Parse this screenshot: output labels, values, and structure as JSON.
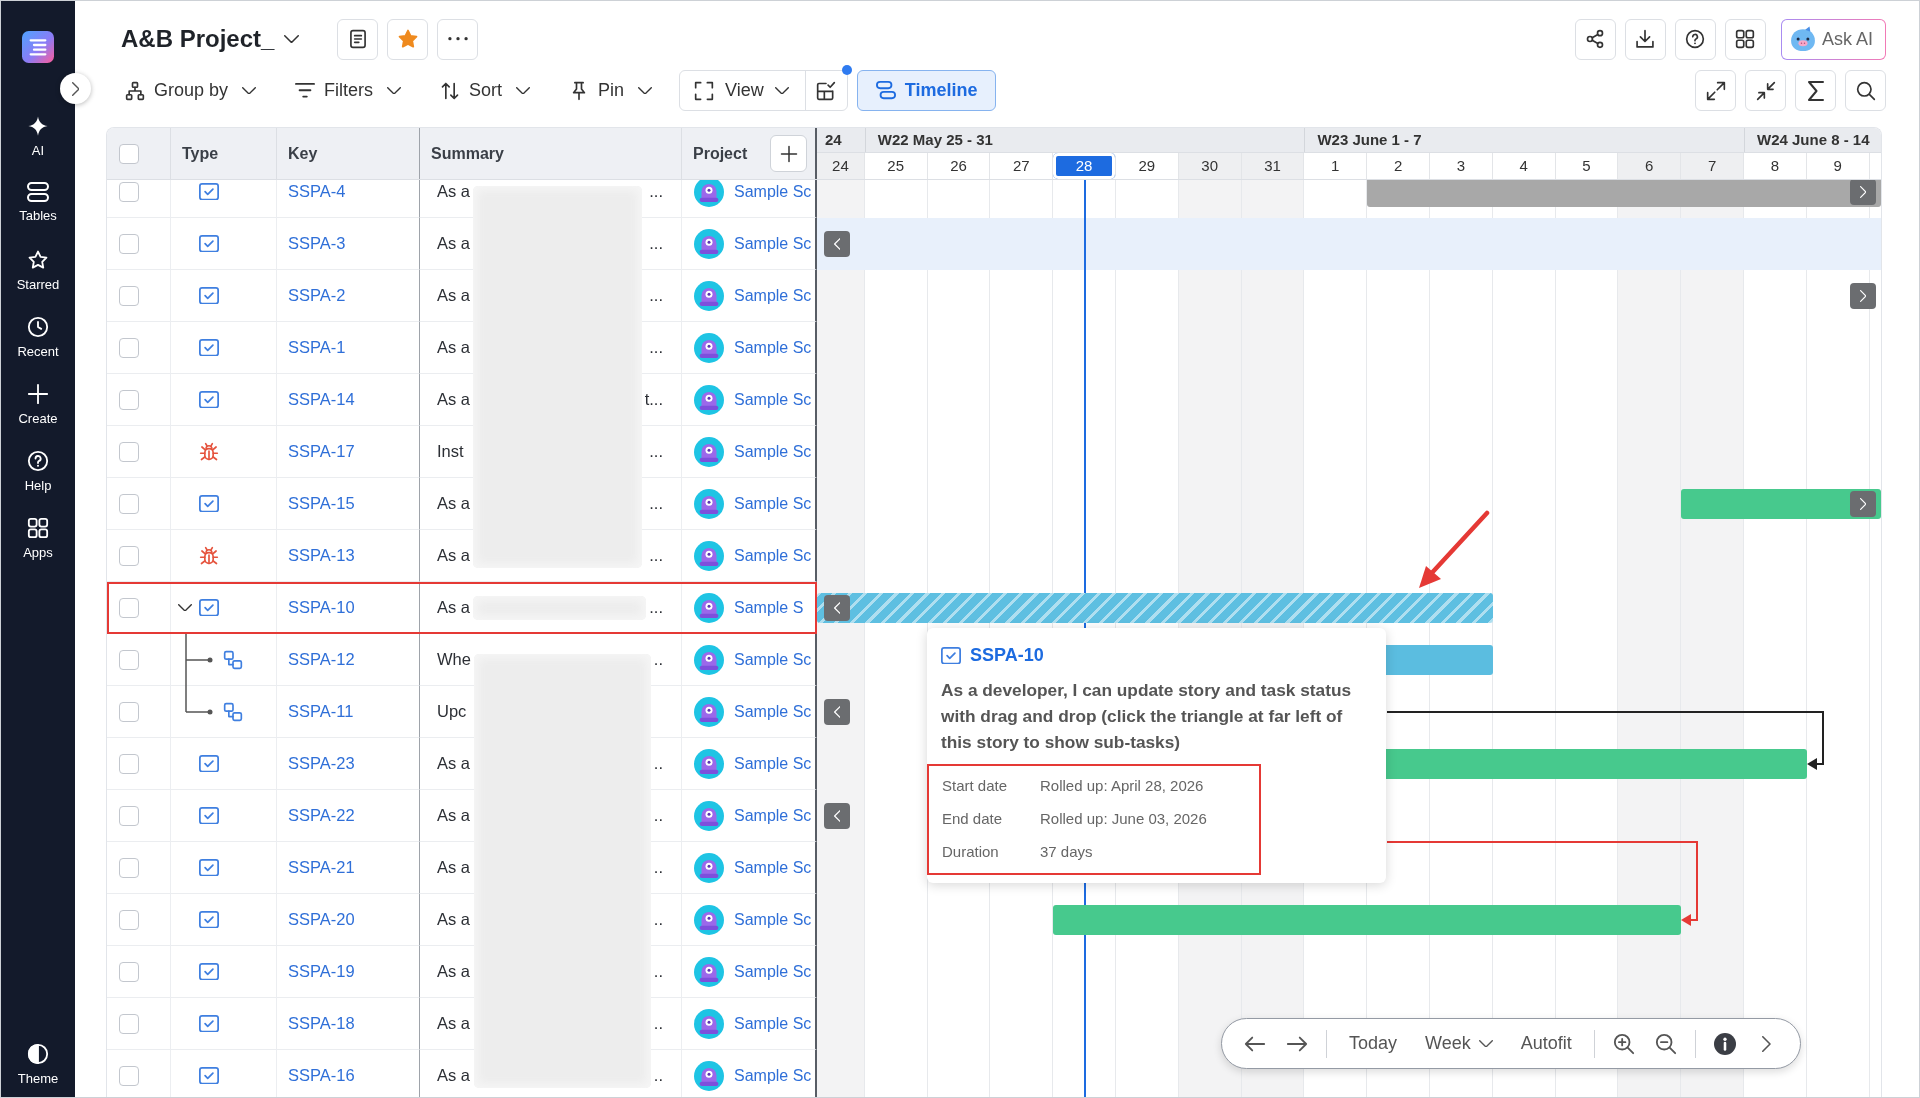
{
  "sidebar": {
    "items": [
      {
        "kind": "ai",
        "label": "AI"
      },
      {
        "kind": "tables",
        "label": "Tables"
      },
      {
        "kind": "starred",
        "label": "Starred"
      },
      {
        "kind": "recent",
        "label": "Recent"
      },
      {
        "kind": "create",
        "label": "Create"
      },
      {
        "kind": "help",
        "label": "Help"
      },
      {
        "kind": "apps",
        "label": "Apps"
      }
    ],
    "footer": [
      {
        "kind": "theme",
        "label": "Theme"
      }
    ]
  },
  "header": {
    "title": "A&B Project_",
    "buttons": [
      {
        "kind": "details"
      },
      {
        "kind": "favorite",
        "starred": true
      },
      {
        "kind": "more"
      }
    ],
    "actions": [
      {
        "kind": "share"
      },
      {
        "kind": "download"
      },
      {
        "kind": "help"
      },
      {
        "kind": "apps"
      },
      {
        "kind": "ask-ai",
        "label": "Ask AI"
      }
    ]
  },
  "toolbar": {
    "items": [
      {
        "kind": "group",
        "label": "Group by"
      },
      {
        "kind": "filter",
        "label": "Filters"
      },
      {
        "kind": "sort",
        "label": "Sort"
      },
      {
        "kind": "pin",
        "label": "Pin"
      }
    ],
    "view": {
      "label": "View",
      "layout_badge": true
    },
    "modes": [
      {
        "label": "Timeline",
        "selected": true
      }
    ],
    "tools": [
      {
        "kind": "expand"
      },
      {
        "kind": "collapse"
      },
      {
        "kind": "sum"
      },
      {
        "kind": "search"
      }
    ]
  },
  "table": {
    "select_all": {
      "checked": false
    },
    "columns": [
      "Type",
      "Key",
      "Summary",
      "Project"
    ],
    "rows": [
      {
        "kind": "story",
        "key": "SSPA-4",
        "summary_start": "As a",
        "summary_end": "...",
        "redaction": {
          "kind": "block"
        },
        "project": "Sample Sc",
        "checked": false,
        "annotated": false,
        "timeline": {
          "hovered": false,
          "earlier": false,
          "later": true,
          "bar": {
            "kind": "task",
            "color": "#a8a8a8",
            "days": [
              {
                "kind": "gap"
              },
              {
                "kind": "gap"
              },
              {
                "kind": "gap"
              },
              {
                "kind": "gap"
              },
              {
                "kind": "gap"
              },
              {
                "kind": "gap"
              },
              {
                "kind": "gap"
              },
              {
                "kind": "gap"
              },
              {
                "kind": "gap"
              },
              {
                "kind": "bar"
              },
              {
                "kind": "bar"
              },
              {
                "kind": "bar"
              },
              {
                "kind": "bar"
              },
              {
                "kind": "bar"
              },
              {
                "kind": "bar"
              },
              {
                "kind": "bar"
              },
              {
                "kind": "bar"
              }
            ]
          }
        }
      },
      {
        "kind": "story",
        "key": "SSPA-3",
        "summary_start": "As a",
        "summary_end": "...",
        "redaction": {
          "kind": "block"
        },
        "project": "Sample Sc",
        "checked": false,
        "annotated": false,
        "timeline": {
          "hovered": true,
          "earlier": true,
          "later": false
        }
      },
      {
        "kind": "story",
        "key": "SSPA-2",
        "summary_start": "As a",
        "summary_end": "...",
        "redaction": {
          "kind": "block"
        },
        "project": "Sample Sc",
        "checked": false,
        "annotated": false,
        "timeline": {
          "hovered": false,
          "earlier": false,
          "later": true
        }
      },
      {
        "kind": "story",
        "key": "SSPA-1",
        "summary_start": "As a",
        "summary_end": "...",
        "redaction": {
          "kind": "block"
        },
        "project": "Sample Sc",
        "checked": false,
        "annotated": false,
        "timeline": {
          "hovered": false,
          "earlier": false,
          "later": false
        }
      },
      {
        "kind": "story",
        "key": "SSPA-14",
        "summary_start": "As a",
        "summary_end": "t...",
        "redaction": {
          "kind": "block"
        },
        "project": "Sample Sc",
        "checked": false,
        "annotated": false,
        "timeline": {
          "hovered": false,
          "earlier": false,
          "later": false
        }
      },
      {
        "kind": "bug",
        "key": "SSPA-17",
        "summary_start": "Inst",
        "summary_end": "...",
        "redaction": {
          "kind": "block"
        },
        "project": "Sample Sc",
        "checked": false,
        "annotated": false,
        "timeline": {
          "hovered": false,
          "earlier": false,
          "later": false
        }
      },
      {
        "kind": "story",
        "key": "SSPA-15",
        "summary_start": "As a",
        "summary_end": "...",
        "redaction": {
          "kind": "block"
        },
        "project": "Sample Sc",
        "checked": false,
        "annotated": false,
        "timeline": {
          "hovered": false,
          "earlier": false,
          "later": true,
          "bar": {
            "kind": "task",
            "color": "#47c98d",
            "days": [
              {
                "kind": "gap"
              },
              {
                "kind": "gap"
              },
              {
                "kind": "gap"
              },
              {
                "kind": "gap"
              },
              {
                "kind": "gap"
              },
              {
                "kind": "gap"
              },
              {
                "kind": "gap"
              },
              {
                "kind": "gap"
              },
              {
                "kind": "gap"
              },
              {
                "kind": "gap"
              },
              {
                "kind": "gap"
              },
              {
                "kind": "gap"
              },
              {
                "kind": "gap"
              },
              {
                "kind": "gap"
              },
              {
                "kind": "bar"
              },
              {
                "kind": "bar"
              },
              {
                "kind": "bar"
              }
            ]
          }
        }
      },
      {
        "kind": "bug",
        "key": "SSPA-13",
        "summary_start": "As a",
        "summary_end": "...",
        "redaction": {
          "kind": "block"
        },
        "project": "Sample Sc",
        "checked": false,
        "annotated": false,
        "timeline": {
          "hovered": false,
          "earlier": false,
          "later": false
        }
      },
      {
        "kind": "story",
        "key": "SSPA-10",
        "summary_start": "As a",
        "summary_end": "...",
        "redaction": {
          "kind": "strip"
        },
        "project": "Sample S",
        "checked": false,
        "annotated": true,
        "expanded": true,
        "timeline": {
          "hovered": false,
          "earlier": true,
          "later": false,
          "bar": {
            "kind": "rollup",
            "color": "#5ebfe1",
            "days": [
              {
                "kind": "bar"
              },
              {
                "kind": "bar"
              },
              {
                "kind": "bar"
              },
              {
                "kind": "bar"
              },
              {
                "kind": "bar"
              },
              {
                "kind": "bar"
              },
              {
                "kind": "bar"
              },
              {
                "kind": "bar"
              },
              {
                "kind": "bar"
              },
              {
                "kind": "bar"
              },
              {
                "kind": "bar"
              },
              {
                "kind": "gap"
              },
              {
                "kind": "gap"
              },
              {
                "kind": "gap"
              },
              {
                "kind": "gap"
              },
              {
                "kind": "gap"
              },
              {
                "kind": "gap"
              }
            ]
          }
        },
        "children": [
          {
            "kind": "subtask",
            "key": "SSPA-12",
            "summary_start": "Whe",
            "summary_end": "..",
            "redaction": {
              "kind": "block"
            },
            "project": "Sample Sc",
            "checked": false,
            "annotated": false,
            "timeline": {
              "hovered": false,
              "earlier": false,
              "later": false,
              "bar": {
                "kind": "task",
                "color": "#5bbde0",
                "days": [
                  {
                    "kind": "gap"
                  },
                  {
                    "kind": "gap"
                  },
                  {
                    "kind": "gap"
                  },
                  {
                    "kind": "gap"
                  },
                  {
                    "kind": "gap"
                  },
                  {
                    "kind": "gap"
                  },
                  {
                    "kind": "gap"
                  },
                  {
                    "kind": "gap"
                  },
                  {
                    "kind": "gap"
                  },
                  {
                    "kind": "bar"
                  },
                  {
                    "kind": "bar"
                  },
                  {
                    "kind": "gap"
                  },
                  {
                    "kind": "gap"
                  },
                  {
                    "kind": "gap"
                  },
                  {
                    "kind": "gap"
                  },
                  {
                    "kind": "gap"
                  },
                  {
                    "kind": "gap"
                  }
                ]
              }
            }
          },
          {
            "kind": "subtask",
            "key": "SSPA-11",
            "summary_start": "Upc",
            "redaction": {
              "kind": "block"
            },
            "project": "Sample Sc",
            "checked": false,
            "annotated": false,
            "timeline": {
              "hovered": false,
              "earlier": true,
              "later": false
            }
          }
        ]
      },
      {
        "kind": "story",
        "key": "SSPA-23",
        "summary_start": "As a",
        "summary_end": "..",
        "redaction": {
          "kind": "block"
        },
        "project": "Sample Sc",
        "checked": false,
        "annotated": false,
        "timeline": {
          "hovered": false,
          "earlier": false,
          "later": false,
          "bar": {
            "kind": "task",
            "color": "#47c98d",
            "days": [
              {
                "kind": "gap"
              },
              {
                "kind": "gap"
              },
              {
                "kind": "gap"
              },
              {
                "kind": "gap"
              },
              {
                "kind": "gap"
              },
              {
                "kind": "gap"
              },
              {
                "kind": "gap"
              },
              {
                "kind": "gap"
              },
              {
                "kind": "gap"
              },
              {
                "kind": "bar"
              },
              {
                "kind": "bar"
              },
              {
                "kind": "bar"
              },
              {
                "kind": "bar"
              },
              {
                "kind": "bar"
              },
              {
                "kind": "bar"
              },
              {
                "kind": "bar"
              },
              {
                "kind": "gap"
              }
            ],
            "link_in": {
              "kind": "center",
              "color": "#222222"
            }
          }
        }
      },
      {
        "kind": "story",
        "key": "SSPA-22",
        "summary_start": "As a",
        "summary_end": "..",
        "redaction": {
          "kind": "block"
        },
        "project": "Sample Sc",
        "checked": false,
        "annotated": false,
        "timeline": {
          "hovered": false,
          "earlier": true,
          "later": false
        }
      },
      {
        "kind": "story",
        "key": "SSPA-21",
        "summary_start": "As a",
        "summary_end": "..",
        "redaction": {
          "kind": "block"
        },
        "project": "Sample Sc",
        "checked": false,
        "annotated": false,
        "timeline": {
          "hovered": false,
          "earlier": false,
          "later": false
        }
      },
      {
        "kind": "story",
        "key": "SSPA-20",
        "summary_start": "As a",
        "summary_end": "..",
        "redaction": {
          "kind": "block"
        },
        "project": "Sample Sc",
        "checked": false,
        "annotated": false,
        "timeline": {
          "hovered": false,
          "earlier": false,
          "later": false,
          "bar": {
            "kind": "task",
            "color": "#47c98d",
            "days": [
              {
                "kind": "gap"
              },
              {
                "kind": "gap"
              },
              {
                "kind": "gap"
              },
              {
                "kind": "gap"
              },
              {
                "kind": "bar"
              },
              {
                "kind": "bar"
              },
              {
                "kind": "bar"
              },
              {
                "kind": "bar"
              },
              {
                "kind": "bar"
              },
              {
                "kind": "bar"
              },
              {
                "kind": "bar"
              },
              {
                "kind": "bar"
              },
              {
                "kind": "bar"
              },
              {
                "kind": "bar"
              },
              {
                "kind": "gap"
              },
              {
                "kind": "gap"
              },
              {
                "kind": "gap"
              }
            ],
            "link_in": {
              "kind": "boundary",
              "color": "#e53935"
            }
          }
        }
      },
      {
        "kind": "story",
        "key": "SSPA-19",
        "summary_start": "As a",
        "summary_end": "..",
        "redaction": {
          "kind": "block"
        },
        "project": "Sample Sc",
        "checked": false,
        "annotated": false,
        "timeline": {
          "hovered": false,
          "earlier": false,
          "later": false
        }
      },
      {
        "kind": "story",
        "key": "SSPA-18",
        "summary_start": "As a",
        "summary_end": "..",
        "redaction": {
          "kind": "block"
        },
        "project": "Sample Sc",
        "checked": false,
        "annotated": false,
        "timeline": {
          "hovered": false,
          "earlier": false,
          "later": false
        }
      },
      {
        "kind": "story",
        "key": "SSPA-16",
        "summary_start": "As a",
        "summary_end": "..",
        "redaction": {
          "kind": "block"
        },
        "project": "Sample Sc",
        "checked": false,
        "annotated": false,
        "timeline": {
          "hovered": false,
          "earlier": false,
          "later": false
        }
      }
    ]
  },
  "timeline": {
    "weeks": [
      {
        "label": "24",
        "days": [
          {
            "label": "24",
            "weekend": true,
            "today": false
          }
        ]
      },
      {
        "label": "W22 May 25 - 31",
        "days": [
          {
            "label": "25",
            "weekend": false,
            "today": false
          },
          {
            "label": "26",
            "weekend": false,
            "today": false
          },
          {
            "label": "27",
            "weekend": false,
            "today": false
          },
          {
            "label": "28",
            "weekend": false,
            "today": true
          },
          {
            "label": "29",
            "weekend": false,
            "today": false
          },
          {
            "label": "30",
            "weekend": true,
            "today": false
          },
          {
            "label": "31",
            "weekend": true,
            "today": false
          }
        ]
      },
      {
        "label": "W23 June 1 - 7",
        "days": [
          {
            "label": "1",
            "weekend": false,
            "today": false
          },
          {
            "label": "2",
            "weekend": false,
            "today": false
          },
          {
            "label": "3",
            "weekend": false,
            "today": false
          },
          {
            "label": "4",
            "weekend": false,
            "today": false
          },
          {
            "label": "5",
            "weekend": false,
            "today": false
          },
          {
            "label": "6",
            "weekend": true,
            "today": false
          },
          {
            "label": "7",
            "weekend": true,
            "today": false
          }
        ]
      },
      {
        "label": "W24 June 8 - 14",
        "days": [
          {
            "label": "8",
            "weekend": false,
            "today": false
          },
          {
            "label": "9",
            "weekend": false,
            "today": false
          }
        ]
      }
    ],
    "tooltip": {
      "kind": "story",
      "key": "SSPA-10",
      "description": "As a developer, I can update story and task status with drag and drop (click the triangle at far left of this story to show sub-tasks)",
      "fields": [
        {
          "label": "Start date",
          "value": "Rolled up: April 28, 2026"
        },
        {
          "label": "End date",
          "value": "Rolled up: June 03, 2026"
        },
        {
          "label": "Duration",
          "value": "37 days"
        }
      ],
      "annotated": true
    },
    "annotation_arrow": true,
    "navigator": {
      "groups": [
        [
          {
            "kind": "back"
          },
          {
            "kind": "forward"
          }
        ],
        [
          {
            "kind": "button",
            "label": "Today"
          },
          {
            "kind": "dropdown",
            "label": "Week"
          },
          {
            "kind": "button",
            "label": "Autofit"
          }
        ],
        [
          {
            "kind": "zoom-in"
          },
          {
            "kind": "zoom-out"
          }
        ],
        [
          {
            "kind": "info"
          },
          {
            "kind": "more"
          }
        ]
      ]
    }
  }
}
